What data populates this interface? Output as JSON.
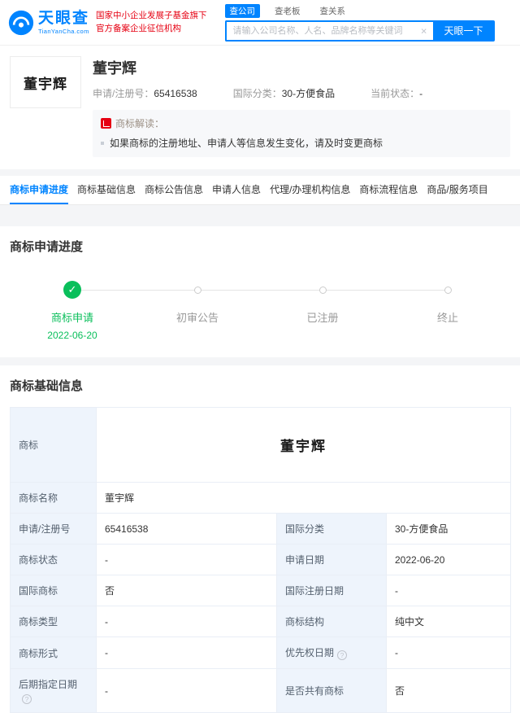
{
  "colors": {
    "brand_blue": "#0084ff",
    "success_green": "#0abf5b",
    "slogan_red": "#e60012",
    "label_cell_bg": "#eef4fc"
  },
  "icons": {
    "clear_icon": "×",
    "check_icon": "✓",
    "info_icon": "?"
  },
  "header": {
    "logo_text": "天眼查",
    "logo_sub": "TianYanCha.com",
    "slogan1": "国家中小企业发展子基金旗下",
    "slogan2": "官方备案企业征信机构",
    "search_tabs": [
      {
        "label": "查公司",
        "active": true
      },
      {
        "label": "查老板",
        "active": false
      },
      {
        "label": "查关系",
        "active": false
      }
    ],
    "search_placeholder": "请输入公司名称、人名、品牌名称等关键词",
    "search_button": "天眼一下"
  },
  "summary": {
    "tm_image_text": "董宇辉",
    "title": "董宇辉",
    "fields": [
      {
        "label": "申请/注册号：",
        "value": "65416538"
      },
      {
        "label": "国际分类：",
        "value": "30-方便食品"
      },
      {
        "label": "当前状态：",
        "value": "-"
      }
    ],
    "interpret_title": "商标解读：",
    "interpret_text": "如果商标的注册地址、申请人等信息发生变化，请及时变更商标"
  },
  "nav": {
    "tabs": [
      "商标申请进度",
      "商标基础信息",
      "商标公告信息",
      "申请人信息",
      "代理/办理机构信息",
      "商标流程信息",
      "商品/服务项目"
    ]
  },
  "progress": {
    "title": "商标申请进度",
    "steps": [
      {
        "label": "商标申请",
        "date": "2022-06-20",
        "state": "done"
      },
      {
        "label": "初审公告",
        "date": "",
        "state": "pending"
      },
      {
        "label": "已注册",
        "date": "",
        "state": "pending"
      },
      {
        "label": "终止",
        "date": "",
        "state": "pending"
      }
    ]
  },
  "basic": {
    "title": "商标基础信息",
    "tm_label": "商标",
    "tm_image_text": "董宇辉",
    "rows": [
      {
        "l1": "商标名称",
        "v1": "董宇辉"
      },
      {
        "l1": "申请/注册号",
        "v1": "65416538",
        "l2": "国际分类",
        "v2": "30-方便食品"
      },
      {
        "l1": "商标状态",
        "v1": "-",
        "l2": "申请日期",
        "v2": "2022-06-20"
      },
      {
        "l1": "国际商标",
        "v1": "否",
        "l2": "国际注册日期",
        "v2": "-"
      },
      {
        "l1": "商标类型",
        "v1": "-",
        "l2": "商标结构",
        "v2": "纯中文"
      },
      {
        "l1": "商标形式",
        "v1": "-",
        "l2": "优先权日期",
        "v2": "-"
      },
      {
        "l1": "后期指定日期",
        "v1": "-",
        "l2": "是否共有商标",
        "v2": "否"
      }
    ]
  }
}
